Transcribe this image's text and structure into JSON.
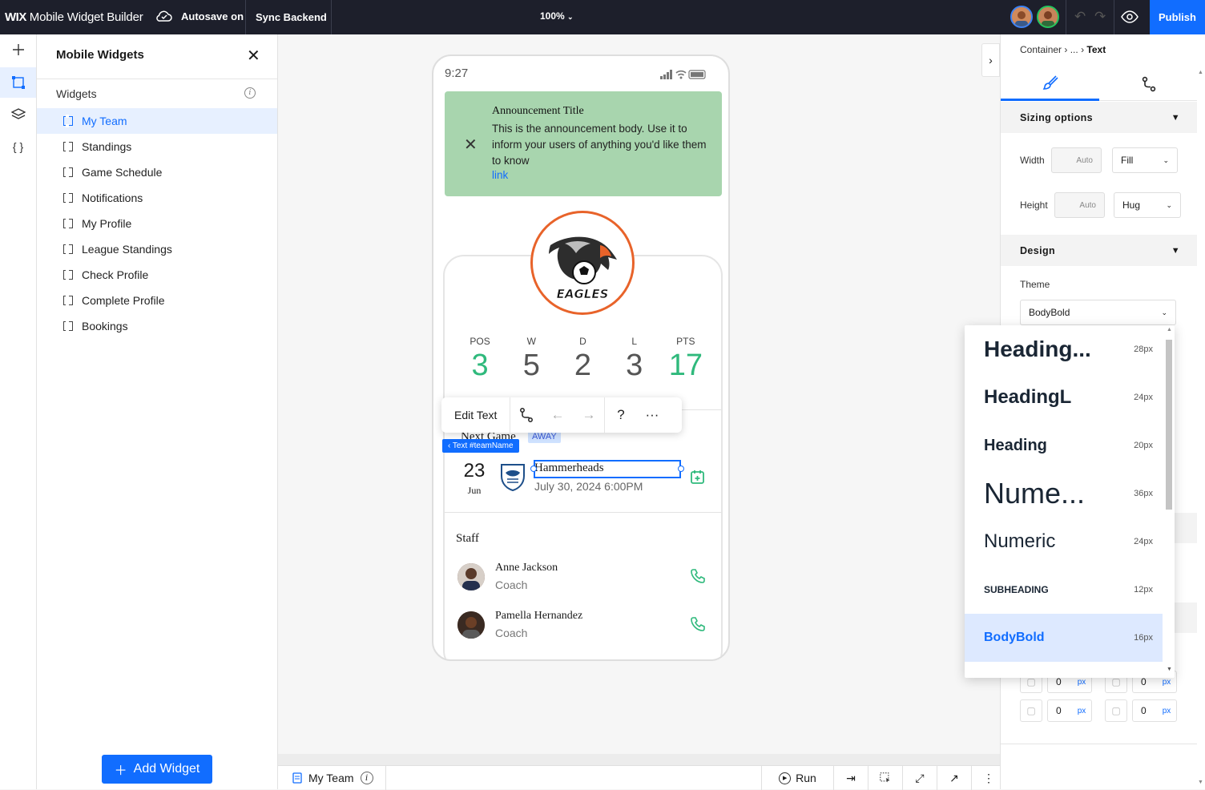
{
  "topbar": {
    "brand_bold": "WIX",
    "brand_rest": " Mobile Widget Builder",
    "autosave": "Autosave on",
    "sync": "Sync Backend",
    "zoom": "100%",
    "publish": "Publish"
  },
  "sidebar": {
    "title": "Mobile Widgets",
    "section": "Widgets",
    "items": [
      {
        "label": "My Team"
      },
      {
        "label": "Standings"
      },
      {
        "label": "Game Schedule"
      },
      {
        "label": "Notifications"
      },
      {
        "label": "My Profile"
      },
      {
        "label": "League Standings"
      },
      {
        "label": "Check Profile"
      },
      {
        "label": "Complete Profile"
      },
      {
        "label": "Bookings"
      }
    ],
    "add_button": "Add Widget"
  },
  "phone": {
    "time": "9:27",
    "announcement": {
      "title": "Announcement Title",
      "body": "This is the announcement body. Use it to inform your users of anything you'd like them to know",
      "link": "link"
    },
    "logo_text": "EAGLES",
    "stats": [
      {
        "label": "POS",
        "value": "3"
      },
      {
        "label": "W",
        "value": "5"
      },
      {
        "label": "D",
        "value": "2"
      },
      {
        "label": "L",
        "value": "3"
      },
      {
        "label": "PTS",
        "value": "17"
      }
    ],
    "next_game": {
      "heading": "Next Game",
      "badge": "AWAY",
      "day": "23",
      "month": "Jun",
      "team": "Hammerheads",
      "datetime": "July 30, 2024 6:00PM"
    },
    "selection_tag": "‹ Text #teamName",
    "staff": {
      "heading": "Staff",
      "people": [
        {
          "name": "Anne Jackson",
          "role": "Coach"
        },
        {
          "name": "Pamella Hernandez",
          "role": "Coach"
        }
      ]
    }
  },
  "toolbar": {
    "edit_text": "Edit Text",
    "help": "?",
    "more": "···"
  },
  "bottombar": {
    "tab": "My Team",
    "run": "Run"
  },
  "rightpanel": {
    "breadcrumb": [
      "Container",
      "...",
      "Text"
    ],
    "sizing": {
      "title": "Sizing options",
      "width_label": "Width",
      "width_placeholder": "Auto",
      "width_mode": "Fill",
      "height_label": "Height",
      "height_placeholder": "Auto",
      "height_mode": "Hug"
    },
    "design": {
      "title": "Design",
      "theme_label": "Theme",
      "theme_value": "BodyBold"
    },
    "padding": [
      {
        "value": "0",
        "unit": "px"
      },
      {
        "value": "0",
        "unit": "px"
      },
      {
        "value": "0",
        "unit": "px"
      },
      {
        "value": "0",
        "unit": "px"
      }
    ]
  },
  "theme_dropdown": {
    "options": [
      {
        "label": "Heading...",
        "size": "28px"
      },
      {
        "label": "HeadingL",
        "size": "24px"
      },
      {
        "label": "Heading",
        "size": "20px"
      },
      {
        "label": "Nume...",
        "size": "36px"
      },
      {
        "label": "Numeric",
        "size": "24px"
      },
      {
        "label": "SUBHEADING",
        "size": "12px"
      },
      {
        "label": "BodyBold",
        "size": "16px",
        "selected": true
      }
    ]
  },
  "colors": {
    "topbar_bg": "#1d1f2b",
    "accent": "#116dff",
    "announcement_bg": "#a8d5ae",
    "stat_green": "#2fb97c"
  }
}
